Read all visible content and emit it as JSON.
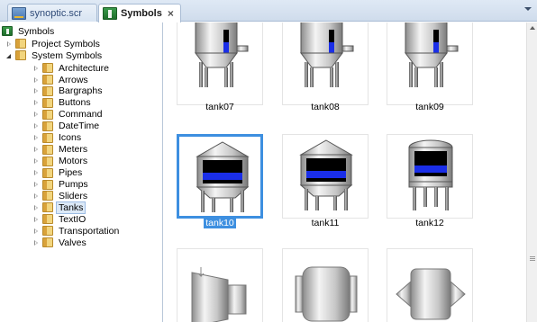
{
  "tabs": [
    {
      "label": "synoptic.scr",
      "active": false
    },
    {
      "label": "Symbols",
      "active": true,
      "close": "×"
    }
  ],
  "tree": {
    "root": "Symbols",
    "project": "Project Symbols",
    "system": "System Symbols",
    "items": [
      "Architecture",
      "Arrows",
      "Bargraphs",
      "Buttons",
      "Command",
      "DateTime",
      "Icons",
      "Meters",
      "Motors",
      "Pipes",
      "Pumps",
      "Sliders",
      "Tanks",
      "TextIO",
      "Transportation",
      "Valves"
    ],
    "selected": "Tanks"
  },
  "symbols": [
    {
      "name": "tank07"
    },
    {
      "name": "tank08"
    },
    {
      "name": "tank09"
    },
    {
      "name": "tank10",
      "selected": true
    },
    {
      "name": "tank11"
    },
    {
      "name": "tank12"
    },
    {
      "name": ""
    },
    {
      "name": ""
    },
    {
      "name": ""
    }
  ],
  "colors": {
    "selection": "#3d8fe0",
    "liquid": "#1a2ee8",
    "steel": "#b8b8b8"
  }
}
